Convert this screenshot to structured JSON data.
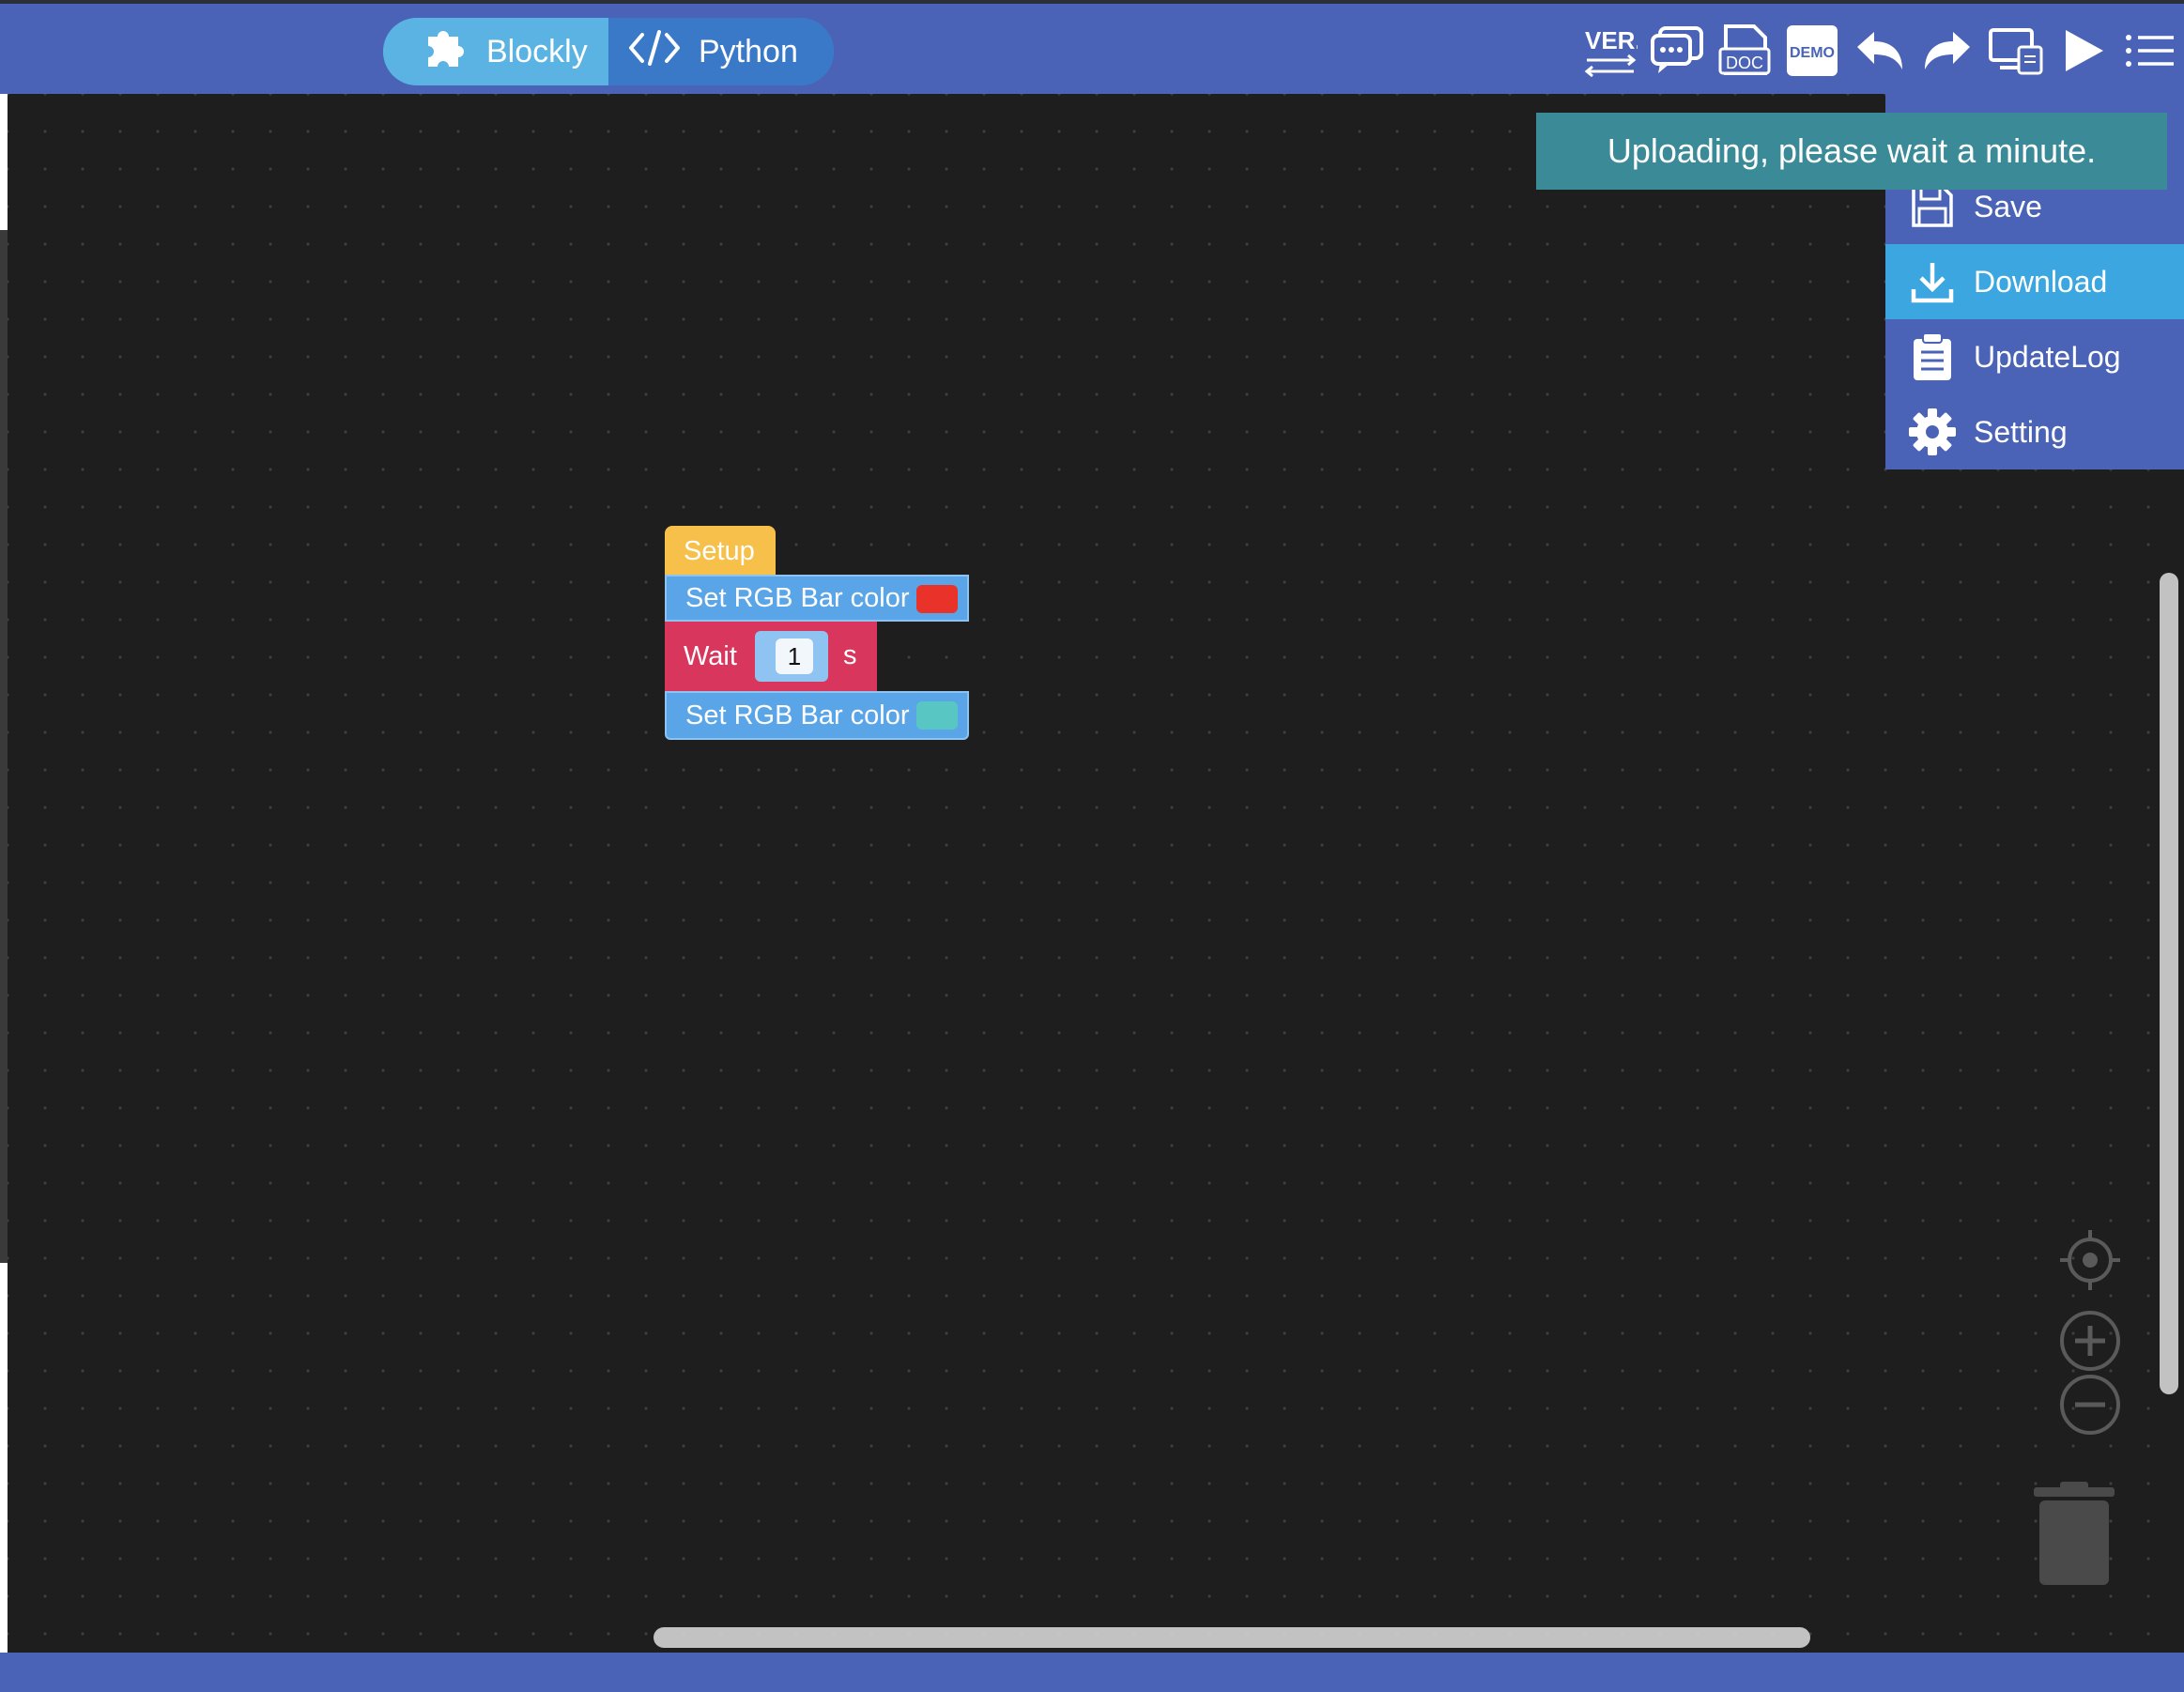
{
  "editor": {
    "modes": [
      {
        "label": "Blockly",
        "icon": "puzzle-piece-icon",
        "active": true
      },
      {
        "label": "Python",
        "icon": "code-icon",
        "active": false
      }
    ],
    "toolbar": [
      {
        "icon": "version-icon",
        "text": "VER."
      },
      {
        "icon": "chat-icon"
      },
      {
        "icon": "doc-icon",
        "text": "DOC"
      },
      {
        "icon": "demo-icon",
        "text": "DEMO"
      },
      {
        "icon": "undo-icon"
      },
      {
        "icon": "redo-icon"
      },
      {
        "icon": "device-icon"
      },
      {
        "icon": "run-icon"
      },
      {
        "icon": "menu-icon"
      }
    ]
  },
  "toast": {
    "message": "Uploading, please wait a minute."
  },
  "menu": {
    "items": [
      {
        "label": "Save",
        "icon": "save-icon"
      },
      {
        "label": "Download",
        "icon": "download-icon",
        "highlighted": true
      },
      {
        "label": "UpdateLog",
        "icon": "clipboard-icon"
      },
      {
        "label": "Setting",
        "icon": "gear-icon"
      }
    ]
  },
  "blocks": {
    "setup": {
      "label": "Setup",
      "color": "#f6c04a"
    },
    "rgb_first": {
      "label": "Set RGB Bar color",
      "swatch": "#e8322a"
    },
    "wait": {
      "label": "Wait",
      "value": "1",
      "unit": "s",
      "color": "#d9365e"
    },
    "rgb_second": {
      "label": "Set RGB Bar color",
      "swatch": "#58c7c4"
    }
  },
  "workspace_controls": [
    "recenter-icon",
    "zoom-in-icon",
    "zoom-out-icon",
    "trash-icon"
  ],
  "colors": {
    "topbar": "#4a63b7",
    "highlight": "#3ba6df",
    "toast": "#3a8a98",
    "workspace": "#1e1e1e"
  }
}
